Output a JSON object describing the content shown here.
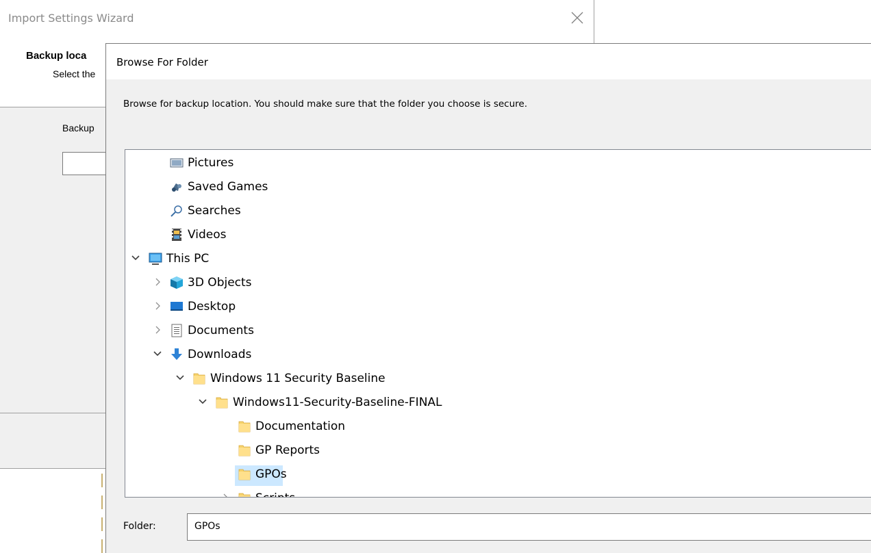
{
  "wizard": {
    "title": "Import Settings Wizard",
    "heading": "Backup loca",
    "subheading": "Select the",
    "field_label": "Backup"
  },
  "browse": {
    "title": "Browse For Folder",
    "description": "Browse for backup location. You should make sure that the folder you choose is secure.",
    "tree": [
      {
        "label": "Pictures",
        "icon": "pictures-icon",
        "expander": "none"
      },
      {
        "label": "Saved Games",
        "icon": "saved-games-icon",
        "expander": "none"
      },
      {
        "label": "Searches",
        "icon": "search-icon",
        "expander": "none"
      },
      {
        "label": "Videos",
        "icon": "videos-icon",
        "expander": "none"
      },
      {
        "label": "This PC",
        "icon": "this-pc-icon",
        "expander": "expanded"
      },
      {
        "label": "3D Objects",
        "icon": "3d-objects-icon",
        "expander": "collapsed"
      },
      {
        "label": "Desktop",
        "icon": "desktop-icon",
        "expander": "collapsed"
      },
      {
        "label": "Documents",
        "icon": "documents-icon",
        "expander": "collapsed"
      },
      {
        "label": "Downloads",
        "icon": "downloads-icon",
        "expander": "expanded"
      },
      {
        "label": "Windows 11 Security Baseline",
        "icon": "folder-icon",
        "expander": "expanded"
      },
      {
        "label": "Windows11-Security-Baseline-FINAL",
        "icon": "folder-icon",
        "expander": "expanded"
      },
      {
        "label": "Documentation",
        "icon": "folder-icon",
        "expander": "none"
      },
      {
        "label": "GP Reports",
        "icon": "folder-icon",
        "expander": "none"
      },
      {
        "label": "GPOs",
        "icon": "folder-icon",
        "expander": "none",
        "selected": true
      },
      {
        "label": "Scripts",
        "icon": "folder-icon",
        "expander": "collapsed"
      }
    ],
    "folder_label": "Folder:",
    "folder_value": "GPOs"
  },
  "colors": {
    "selection": "#cce8ff",
    "folder": "#ffd76e",
    "chrome": "#f0f0f0"
  }
}
